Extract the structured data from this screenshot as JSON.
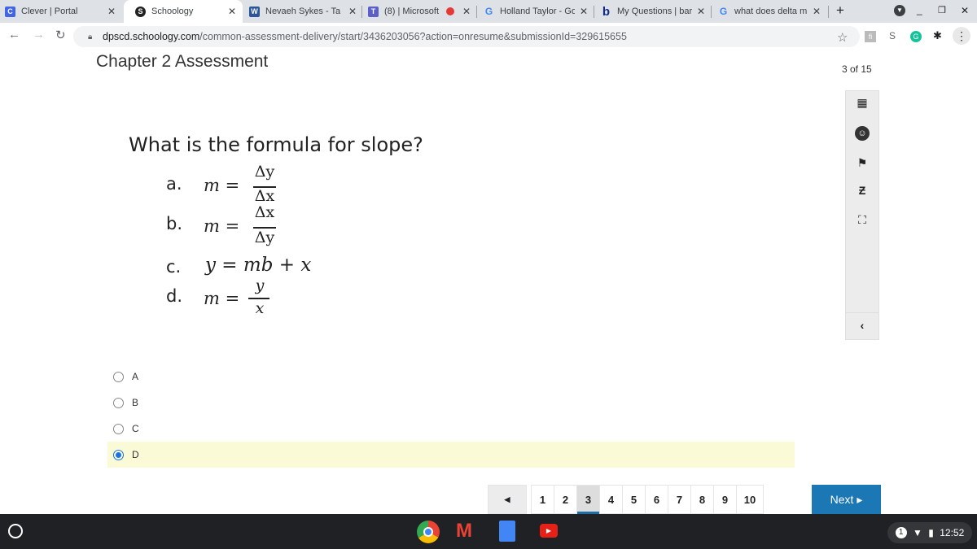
{
  "browser": {
    "tabs": [
      {
        "title": "Clever | Portal",
        "icon": "clever-icon",
        "color": "#4264e6"
      },
      {
        "title": "Schoology",
        "icon": "schoology-icon",
        "color": "#222222"
      },
      {
        "title": "Nevaeh Sykes - Ta",
        "icon": "word-icon",
        "color": "#2b579a"
      },
      {
        "title": "(8) | Microsoft",
        "icon": "teams-icon",
        "color": "#5b5fc7"
      },
      {
        "title": "Holland Taylor - Go",
        "icon": "google-icon",
        "color": "#4285f4"
      },
      {
        "title": "My Questions | bar",
        "icon": "bartleby-icon",
        "color": "#0f2a8c"
      },
      {
        "title": "what does delta m",
        "icon": "google-icon",
        "color": "#4285f4"
      }
    ],
    "url_domain": "dpscd.schoology.com",
    "url_path": "/common-assessment-delivery/start/3436203056?action=onresume&submissionId=329615655"
  },
  "assessment": {
    "title": "Chapter 2 Assessment",
    "counter": "3 of 15",
    "question": "What is the formula for slope?",
    "choices": [
      {
        "label": "a.",
        "lhs": "m =",
        "num": "Δy",
        "den": "Δx"
      },
      {
        "label": "b.",
        "lhs": "m =",
        "num": "Δx",
        "den": "Δy"
      },
      {
        "label": "c.",
        "expr": "y = mb + x"
      },
      {
        "label": "d.",
        "lhs": "m =",
        "num": "y",
        "den": "x"
      }
    ],
    "options": [
      "A",
      "B",
      "C",
      "D"
    ],
    "selected": "D",
    "pages": [
      "1",
      "2",
      "3",
      "4",
      "5",
      "6",
      "7",
      "8",
      "9",
      "10"
    ],
    "current_page": "3",
    "next_label": "Next ▸",
    "highlight_color": "#fafad7",
    "accent_color": "#1c78b4"
  },
  "system": {
    "time": "12:52",
    "notifications": "1"
  }
}
